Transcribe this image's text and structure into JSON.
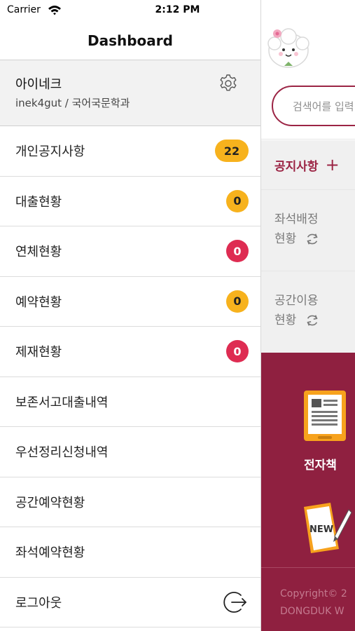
{
  "status_bar": {
    "carrier": "Carrier",
    "time": "2:12 PM"
  },
  "drawer": {
    "title": "Dashboard",
    "profile": {
      "name": "아이네크",
      "subtitle": "inek4gut / 국어국문학과"
    },
    "items": [
      {
        "label": "개인공지사항",
        "badge": "22",
        "badge_color": "#f7b21d"
      },
      {
        "label": "대출현황",
        "badge": "0",
        "badge_color": "#f7b21d"
      },
      {
        "label": "연체현황",
        "badge": "0",
        "badge_color": "#de2c52"
      },
      {
        "label": "예약현황",
        "badge": "0",
        "badge_color": "#f7b21d"
      },
      {
        "label": "제재현황",
        "badge": "0",
        "badge_color": "#de2c52"
      },
      {
        "label": "보존서고대출내역"
      },
      {
        "label": "우선정리신청내역"
      },
      {
        "label": "공간예약현황"
      },
      {
        "label": "좌석예약현황"
      },
      {
        "label": "로그아웃",
        "icon": "logout-icon"
      }
    ]
  },
  "background": {
    "search_placeholder": "검색어를 입력",
    "notice_label": "공지사항",
    "seat_status": {
      "line1": "좌석배정",
      "line2": "현황"
    },
    "space_status": {
      "line1": "공간이용",
      "line2": "현황"
    },
    "ebook_label": "전자책",
    "new_label": "NEW",
    "copyright_line1": "Copyright© 2",
    "copyright_line2": "DONGDUK W",
    "colors": {
      "accent": "#8f2040",
      "badge_orange": "#f7b21d",
      "badge_red": "#de2c52"
    }
  }
}
